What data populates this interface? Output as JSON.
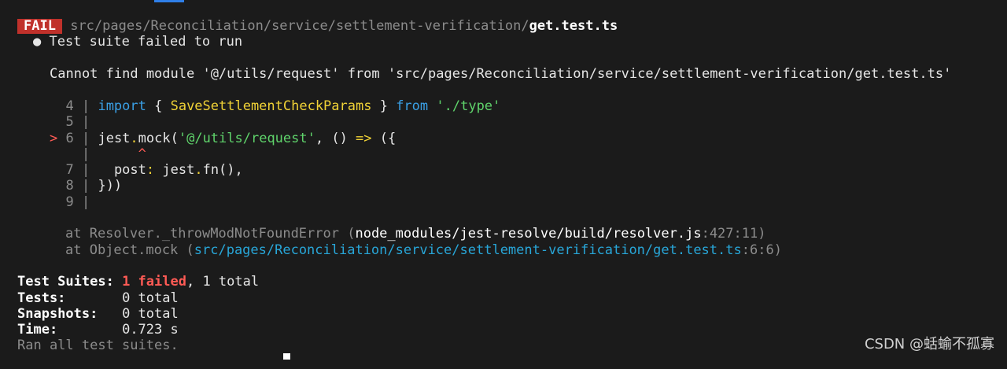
{
  "header": {
    "badge": "FAIL",
    "path_prefix": "src/pages/Reconciliation/service/settlement-verification/",
    "file_name": "get.test.ts"
  },
  "suite_failed": "● Test suite failed to run",
  "error_message": "Cannot find module '@/utils/request' from 'src/pages/Reconciliation/service/settlement-verification/get.test.ts'",
  "code": {
    "lines": {
      "l4": {
        "num": "4",
        "import_kw": "import",
        "import_rest_open": " { ",
        "import_name": "SaveSettlementCheckParams",
        "import_rest_close": " } ",
        "from_kw": "from",
        "import_path": "'./type'"
      },
      "l5": {
        "num": "5"
      },
      "l6": {
        "marker": ">",
        "num": "6",
        "jest": "jest",
        "dot": ".",
        "mock": "mock(",
        "arg": "'@/utils/request'",
        "rest": ", () ",
        "arrow": "=>",
        "tail": " ({"
      },
      "caret": "^",
      "l7": {
        "num": "7",
        "post": "post",
        "colon": ":",
        "jest": " jest",
        "dot": ".",
        "fn": "fn(),",
        "comma": ","
      },
      "l8": {
        "num": "8",
        "text": "}))"
      },
      "l9": {
        "num": "9"
      }
    }
  },
  "stack": {
    "frame1": {
      "at": "at Resolver._throwModNotFoundError (",
      "file": "node_modules/jest-resolve/build/resolver.js",
      "pos": ":427:11)"
    },
    "frame2": {
      "at": "at Object.mock (",
      "file": "src/pages/Reconciliation/service/settlement-verification/get.test.ts",
      "pos": ":6:6)"
    }
  },
  "summary": {
    "suites_label": "Test Suites:",
    "suites_failed": "1 failed",
    "suites_total": ", 1 total",
    "tests_label": "Tests:",
    "tests_value": "0 total",
    "snapshots_label": "Snapshots:",
    "snapshots_value": "0 total",
    "time_label": "Time:",
    "time_value": "0.723 s",
    "ran": "Ran all test suites."
  },
  "watermark": "CSDN @蛞蝓不孤寡",
  "colors": {
    "fail_badge": "#c0312b",
    "keyword_blue": "#3aa0e6",
    "identifier_yellow": "#f0d236",
    "string_green": "#5fd36b",
    "failed_red": "#ff5b55"
  }
}
